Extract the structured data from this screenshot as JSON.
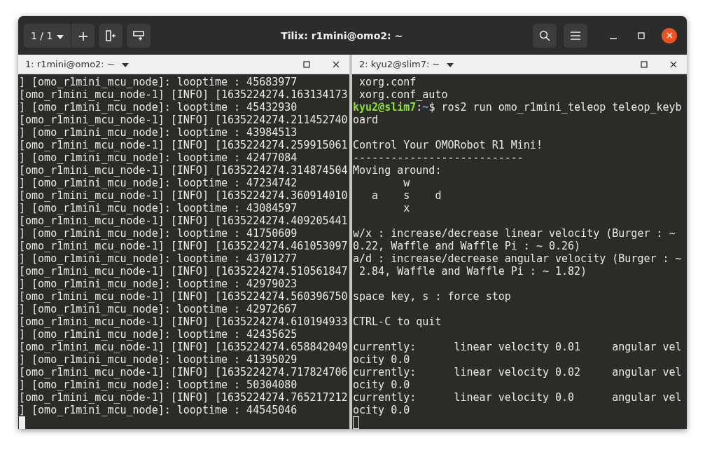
{
  "window": {
    "title": "Tilix: r1mini@omo2: ~",
    "session_switcher": "1 / 1",
    "add_session": "+"
  },
  "panes": [
    {
      "title": "1: r1mini@omo2: ~",
      "focused": true,
      "lines": [
        {
          "kind": "text",
          "text": "] [omo_r1mini_mcu_node]: looptime : 45683977"
        },
        {
          "kind": "text",
          "text": "[omo_r1mini_mcu_node-1] [INFO] [1635224274.163134173"
        },
        {
          "kind": "text",
          "text": "] [omo_r1mini_mcu_node]: looptime : 45432930"
        },
        {
          "kind": "text",
          "text": "[omo_r1mini_mcu_node-1] [INFO] [1635224274.211452740"
        },
        {
          "kind": "text",
          "text": "] [omo_r1mini_mcu_node]: looptime : 43984513"
        },
        {
          "kind": "text",
          "text": "[omo_r1mini_mcu_node-1] [INFO] [1635224274.259915061"
        },
        {
          "kind": "text",
          "text": "] [omo_r1mini_mcu_node]: looptime : 42477084"
        },
        {
          "kind": "text",
          "text": "[omo_r1mini_mcu_node-1] [INFO] [1635224274.314874504"
        },
        {
          "kind": "text",
          "text": "] [omo_r1mini_mcu_node]: looptime : 47234742"
        },
        {
          "kind": "text",
          "text": "[omo_r1mini_mcu_node-1] [INFO] [1635224274.360914010"
        },
        {
          "kind": "text",
          "text": "] [omo_r1mini_mcu_node]: looptime : 43084597"
        },
        {
          "kind": "text",
          "text": "[omo_r1mini_mcu_node-1] [INFO] [1635224274.409205441"
        },
        {
          "kind": "text",
          "text": "] [omo_r1mini_mcu_node]: looptime : 41750609"
        },
        {
          "kind": "text",
          "text": "[omo_r1mini_mcu_node-1] [INFO] [1635224274.461053097"
        },
        {
          "kind": "text",
          "text": "] [omo_r1mini_mcu_node]: looptime : 43701277"
        },
        {
          "kind": "text",
          "text": "[omo_r1mini_mcu_node-1] [INFO] [1635224274.510561847"
        },
        {
          "kind": "text",
          "text": "] [omo_r1mini_mcu_node]: looptime : 42979023"
        },
        {
          "kind": "text",
          "text": "[omo_r1mini_mcu_node-1] [INFO] [1635224274.560396750"
        },
        {
          "kind": "text",
          "text": "] [omo_r1mini_mcu_node]: looptime : 42972667"
        },
        {
          "kind": "text",
          "text": "[omo_r1mini_mcu_node-1] [INFO] [1635224274.610194933"
        },
        {
          "kind": "text",
          "text": "] [omo_r1mini_mcu_node]: looptime : 42435625"
        },
        {
          "kind": "text",
          "text": "[omo_r1mini_mcu_node-1] [INFO] [1635224274.658842049"
        },
        {
          "kind": "text",
          "text": "] [omo_r1mini_mcu_node]: looptime : 41395029"
        },
        {
          "kind": "text",
          "text": "[omo_r1mini_mcu_node-1] [INFO] [1635224274.717824706"
        },
        {
          "kind": "text",
          "text": "] [omo_r1mini_mcu_node]: looptime : 50304080"
        },
        {
          "kind": "text",
          "text": "[omo_r1mini_mcu_node-1] [INFO] [1635224274.765217212"
        },
        {
          "kind": "text",
          "text": "] [omo_r1mini_mcu_node]: looptime : 44545046"
        }
      ]
    },
    {
      "title": "2: kyu2@slim7: ~",
      "focused": false,
      "lines": [
        {
          "kind": "text",
          "text": " xorg.conf"
        },
        {
          "kind": "text",
          "text": " xorg.conf_auto"
        },
        {
          "kind": "prompt",
          "user_host": "kyu2@slim7",
          "separator": ":",
          "path": "~",
          "text": "$ ros2 run omo_r1mini_teleop teleop_keyb"
        },
        {
          "kind": "text",
          "text": "oard"
        },
        {
          "kind": "blank"
        },
        {
          "kind": "text",
          "text": "Control Your OMORobot R1 Mini!"
        },
        {
          "kind": "text",
          "text": "---------------------------"
        },
        {
          "kind": "text",
          "text": "Moving around:"
        },
        {
          "kind": "text",
          "text": "        w"
        },
        {
          "kind": "text",
          "text": "   a    s    d"
        },
        {
          "kind": "text",
          "text": "        x"
        },
        {
          "kind": "blank"
        },
        {
          "kind": "text",
          "text": "w/x : increase/decrease linear velocity (Burger : ~"
        },
        {
          "kind": "text",
          "text": "0.22, Waffle and Waffle Pi : ~ 0.26)"
        },
        {
          "kind": "text",
          "text": "a/d : increase/decrease angular velocity (Burger : ~"
        },
        {
          "kind": "text",
          "text": " 2.84, Waffle and Waffle Pi : ~ 1.82)"
        },
        {
          "kind": "blank"
        },
        {
          "kind": "text",
          "text": "space key, s : force stop"
        },
        {
          "kind": "blank"
        },
        {
          "kind": "text",
          "text": "CTRL-C to quit"
        },
        {
          "kind": "blank"
        },
        {
          "kind": "text",
          "text": "currently:      linear velocity 0.01     angular vel"
        },
        {
          "kind": "text",
          "text": "ocity 0.0"
        },
        {
          "kind": "text",
          "text": "currently:      linear velocity 0.02     angular vel"
        },
        {
          "kind": "text",
          "text": "ocity 0.0"
        },
        {
          "kind": "text",
          "text": "currently:      linear velocity 0.0      angular vel"
        },
        {
          "kind": "text",
          "text": "ocity 0.0"
        }
      ]
    }
  ]
}
